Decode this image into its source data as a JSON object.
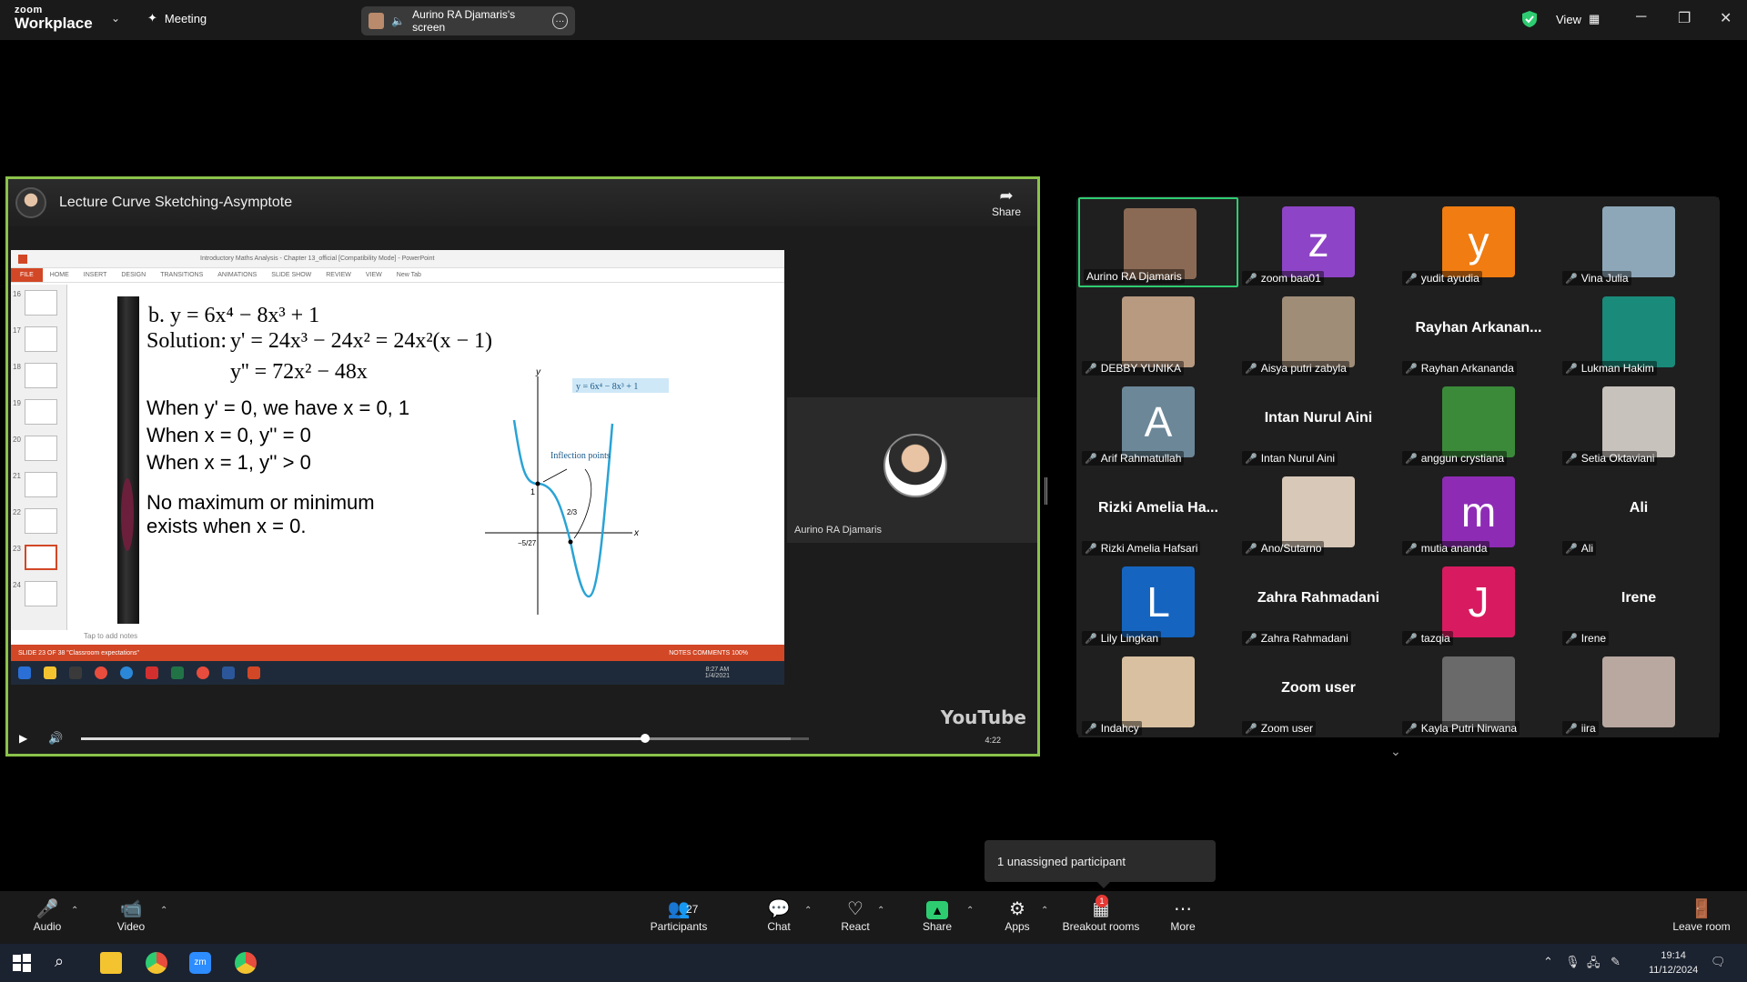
{
  "titlebar": {
    "logo_top": "zoom",
    "logo_bottom": "Workplace",
    "meeting_label": "Meeting",
    "screen_share_label": "Aurino RA Djamaris's screen",
    "view_label": "View"
  },
  "shared_screen": {
    "video_title": "Lecture Curve Sketching-Asymptote",
    "share_label": "Share",
    "ppt_title": "Introductory Maths Analysis - Chapter 13_official [Compatibility Mode] - PowerPoint",
    "ppt_tabs": [
      "FILE",
      "HOME",
      "INSERT",
      "DESIGN",
      "TRANSITIONS",
      "ANIMATIONS",
      "SLIDE SHOW",
      "REVIEW",
      "VIEW",
      "New Tab"
    ],
    "thumb_numbers": [
      "16",
      "17",
      "18",
      "19",
      "20",
      "21",
      "22",
      "23",
      "24"
    ],
    "slide": {
      "line1": "b. y = 6x⁴ − 8x³ + 1",
      "line2_label": "Solution:",
      "line2": "y' = 24x³ − 24x² = 24x²(x − 1)",
      "line3": "y'' = 72x² − 48x",
      "line4": "When  y' = 0, we have  x = 0,  1",
      "line5": "When x = 0,  y'' = 0",
      "line6": "When x = 1,  y'' > 0",
      "line7": "No maximum or minimum",
      "line8": "exists when x = 0.",
      "graph_label": "y = 6x⁴ − 8x³ + 1",
      "inflection_label": "Inflection points",
      "axis_y": "y",
      "axis_x": "x",
      "tick_1": "1",
      "tick_23": "2/3",
      "tick_527": "−5/27"
    },
    "notes_placeholder": "Tap to add notes",
    "status_text": "SLIDE 23 OF 38    \"Classroom expectations\"",
    "status_right": "NOTES   COMMENTS   100%",
    "win_clock_time": "8:27 AM",
    "win_clock_date": "1/4/2021",
    "cam_name": "Aurino RA Djamaris",
    "yt_logo": "YouTube",
    "yt_time": "4:22"
  },
  "gallery": {
    "participants": [
      {
        "name": "Aurino RA Djamaris",
        "type": "photo",
        "color": "#8a6a55",
        "muted": false,
        "active": true
      },
      {
        "name": "zoom baa01",
        "type": "letter",
        "letter": "z",
        "color": "#8e44c7",
        "muted": true
      },
      {
        "name": "yudit ayudia",
        "type": "letter",
        "letter": "y",
        "color": "#f07c12",
        "muted": true
      },
      {
        "name": "Vina Julia",
        "type": "photo",
        "color": "#8da7b8",
        "muted": true
      },
      {
        "name": "DEBBY YUNIKA",
        "type": "photo",
        "color": "#b89a80",
        "muted": true
      },
      {
        "name": "Aisya putri zabyla",
        "type": "photo",
        "color": "#a08d78",
        "muted": true
      },
      {
        "name": "Rayhan Arkananda",
        "type": "text",
        "display": "Rayhan  Arkanan...",
        "muted": true
      },
      {
        "name": "Lukman Hakim",
        "type": "photo",
        "color": "#1a8a7a",
        "muted": true
      },
      {
        "name": "Arif Rahmatullah",
        "type": "letter",
        "letter": "A",
        "color": "#6b8798",
        "muted": true
      },
      {
        "name": "Intan Nurul Aini",
        "type": "text",
        "display": "Intan Nurul Aini",
        "muted": true
      },
      {
        "name": "anggun crystiana",
        "type": "photo",
        "color": "#3a8a3a",
        "muted": true
      },
      {
        "name": "Setia Oktaviani",
        "type": "photo",
        "color": "#c8c2bc",
        "muted": true
      },
      {
        "name": "Rizki Amelia Hafsari",
        "type": "text",
        "display": "Rizki  Amelia Ha...",
        "muted": true
      },
      {
        "name": "Ano/Sutarno",
        "type": "photo",
        "color": "#d8c8b8",
        "muted": true
      },
      {
        "name": "mutia ananda",
        "type": "letter",
        "letter": "m",
        "color": "#8e2bb5",
        "muted": true
      },
      {
        "name": "Ali",
        "type": "text",
        "display": "Ali",
        "muted": true
      },
      {
        "name": "Lily Lingkan",
        "type": "letter",
        "letter": "L",
        "color": "#1565c0",
        "muted": true
      },
      {
        "name": "Zahra Rahmadani",
        "type": "text",
        "display": "Zahra Rahmadani",
        "muted": true
      },
      {
        "name": "tazqia",
        "type": "letter",
        "letter": "J",
        "color": "#d81b60",
        "muted": true
      },
      {
        "name": "Irene",
        "type": "text",
        "display": "Irene",
        "muted": true
      },
      {
        "name": "Indahcy",
        "type": "photo",
        "color": "#d8c0a0",
        "muted": true
      },
      {
        "name": "Zoom user",
        "type": "text",
        "display": "Zoom user",
        "muted": true
      },
      {
        "name": "Kayla Putri Nirwana",
        "type": "photo",
        "color": "#6a6a6a",
        "muted": true
      },
      {
        "name": "iira",
        "type": "photo",
        "color": "#b8a8a0",
        "muted": true
      }
    ]
  },
  "tooltip": "1 unassigned participant",
  "toolbar": {
    "audio": "Audio",
    "video": "Video",
    "participants": "Participants",
    "participants_count": "27",
    "chat": "Chat",
    "react": "React",
    "share": "Share",
    "apps": "Apps",
    "breakout": "Breakout rooms",
    "breakout_badge": "1",
    "more": "More",
    "leave": "Leave room"
  },
  "taskbar": {
    "time": "19:14",
    "date": "11/12/2024"
  }
}
